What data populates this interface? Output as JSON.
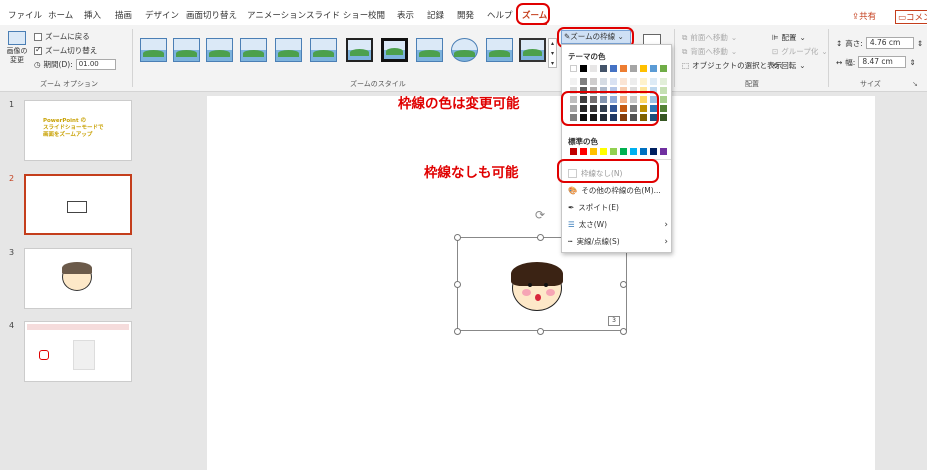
{
  "tabs": [
    "ファイル",
    "ホーム",
    "挿入",
    "描画",
    "デザイン",
    "画面切り替え",
    "アニメーション",
    "スライド ショー",
    "校閲",
    "表示",
    "記録",
    "開発",
    "ヘルプ"
  ],
  "active_tab": "ズーム",
  "header": {
    "share": "共有",
    "comment": "コメン"
  },
  "zoom_options": {
    "change_image": "画像の\n変更",
    "return_label": "ズームに戻る",
    "transition_label": "ズーム切り替え",
    "duration_label": "期間(D):",
    "duration_value": "01.00",
    "group": "ズーム オプション"
  },
  "styles_group": "ズームのスタイル",
  "border_button": "ズームの枠線",
  "arrange": {
    "forward": "前面へ移動",
    "backward": "背面へ移動",
    "selection": "オブジェクトの選択と表示",
    "align": "配置",
    "group_obj": "グループ化",
    "rotate": "回転",
    "group": "配置"
  },
  "size": {
    "height_label": "高さ:",
    "height_value": "4.76 cm",
    "width_label": "幅:",
    "width_value": "8.47 cm",
    "group": "サイズ"
  },
  "border_menu": {
    "theme_colors": "テーマの色",
    "standard_colors": "標準の色",
    "no_border": "枠線なし(N)",
    "more_colors": "その他の枠線の色(M)...",
    "eyedropper": "スポイト(E)",
    "weight": "太さ(W)",
    "dashes": "実線/点線(S)"
  },
  "slides": [
    {
      "num": "1",
      "title": "PowerPoint の\nスライドショーモードで\n画面をズームアップ"
    },
    {
      "num": "2",
      "slide_ref": "3"
    },
    {
      "num": "3"
    },
    {
      "num": "4"
    }
  ],
  "zoom_slide_number": "3",
  "notes": {
    "color_change": "枠線の色は変更可能",
    "no_border": "枠線なしも可能"
  },
  "colors": {
    "accent": "#c43e1c",
    "highlight_red": "#e00000"
  }
}
